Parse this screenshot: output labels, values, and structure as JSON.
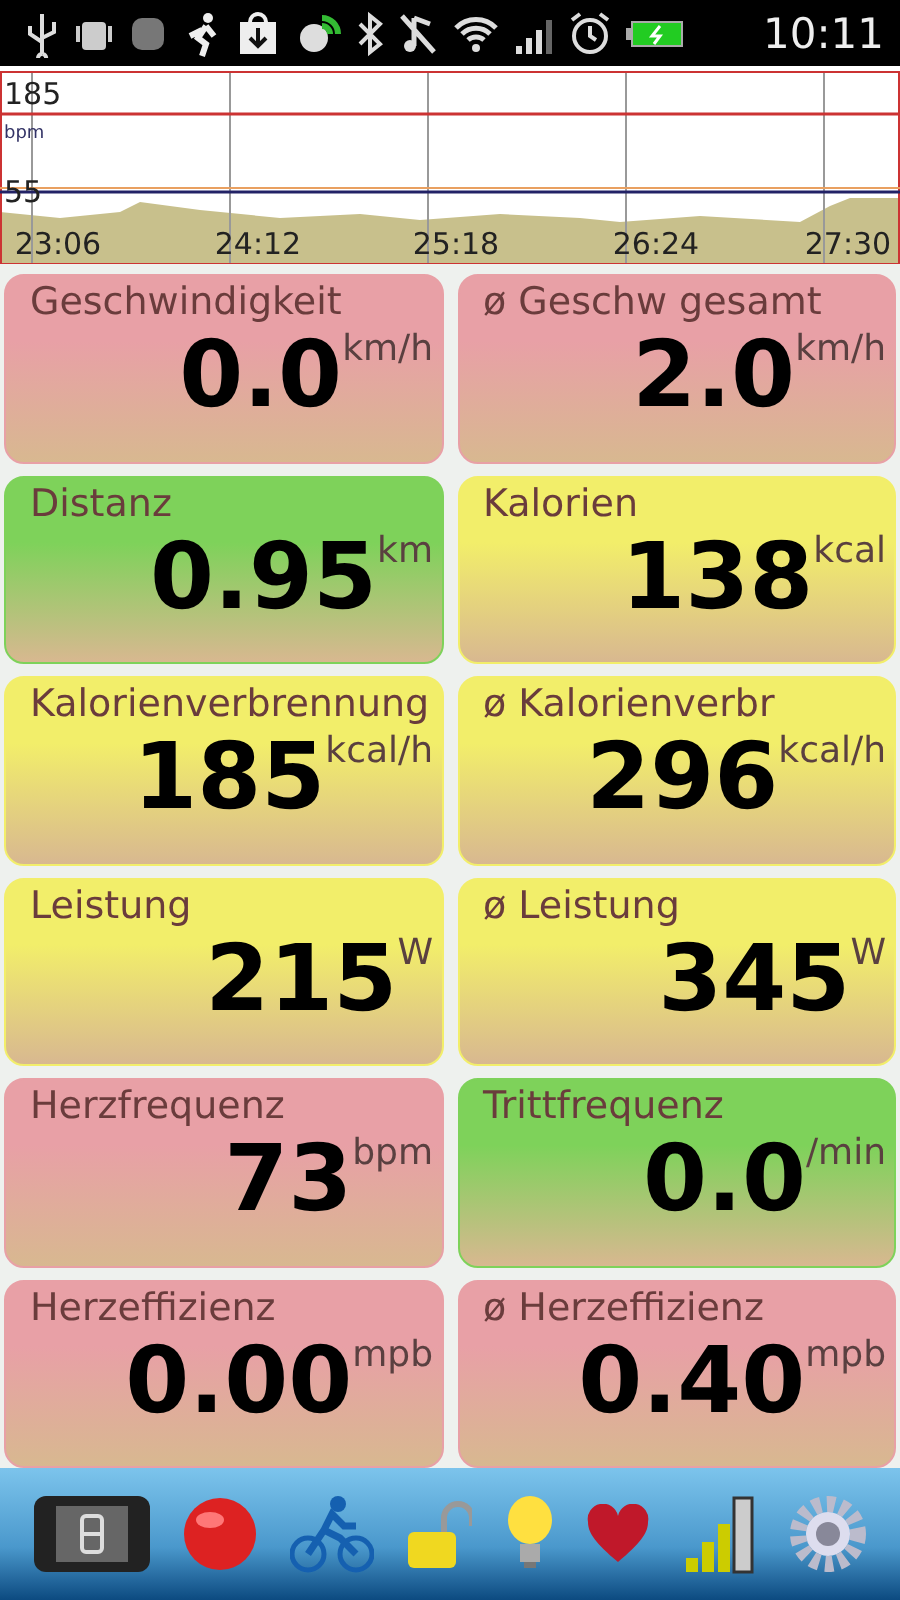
{
  "status_bar": {
    "time": "10:11"
  },
  "chart": {
    "y_labels": [
      "185",
      "55"
    ],
    "unit": "bpm",
    "x_labels": [
      "23:06",
      "24:12",
      "25:18",
      "26:24",
      "27:30"
    ]
  },
  "tiles": [
    {
      "label": "Geschwindigkeit",
      "value": "0.0",
      "unit": "km/h",
      "color": "#e8a0a6"
    },
    {
      "label": "ø Geschw gesamt",
      "value": "2.0",
      "unit": "km/h",
      "color": "#e8a0a6"
    },
    {
      "label": "Distanz",
      "value": "0.95",
      "unit": "km",
      "color": "#7ed25a"
    },
    {
      "label": "Kalorien",
      "value": "138",
      "unit": "kcal",
      "color": "#f2ee6a"
    },
    {
      "label": "Kalorienverbrennung",
      "value": "185",
      "unit": "kcal/h",
      "color": "#f2ee6a"
    },
    {
      "label": "ø Kalorienverbr",
      "value": "296",
      "unit": "kcal/h",
      "color": "#f2ee6a"
    },
    {
      "label": "Leistung",
      "value": "215",
      "unit": "W",
      "color": "#f2ee6a"
    },
    {
      "label": "ø Leistung",
      "value": "345",
      "unit": "W",
      "color": "#f2ee6a"
    },
    {
      "label": "Herzfrequenz",
      "value": "73",
      "unit": "bpm",
      "color": "#e8a0a6"
    },
    {
      "label": "Trittfrequenz",
      "value": "0.0",
      "unit": "/min",
      "color": "#7ed25a"
    },
    {
      "label": "Herzeffizienz",
      "value": "0.00",
      "unit": "mpb",
      "color": "#e8a0a6"
    },
    {
      "label": "ø Herzeffizienz",
      "value": "0.40",
      "unit": "mpb",
      "color": "#e8a0a6"
    }
  ]
}
